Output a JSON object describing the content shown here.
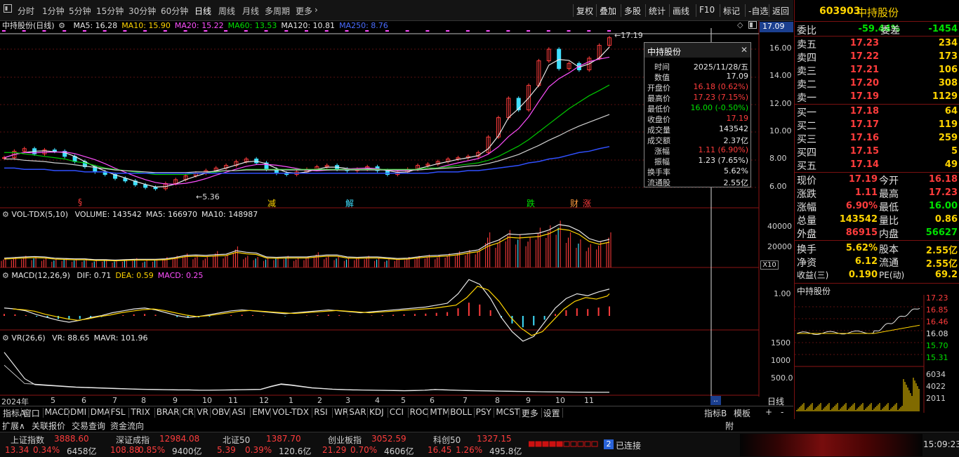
{
  "toolbar": {
    "periods": [
      "分时",
      "1分钟",
      "5分钟",
      "15分钟",
      "30分钟",
      "60分钟",
      "日线",
      "周线",
      "月线",
      "多周期",
      "更多"
    ],
    "active_period": "日线",
    "right_buttons": [
      "复权",
      "叠加",
      "多股",
      "统计",
      "画线",
      "F10",
      "标记",
      "-自选",
      "返回"
    ]
  },
  "stock": {
    "code": "603903",
    "name": "中持股份"
  },
  "main_legend": {
    "title": "中持股份(日线)",
    "items": [
      {
        "text": "MA5: 16.28",
        "color": "#e8e8e8"
      },
      {
        "text": "MA10: 15.90",
        "color": "#ffd400"
      },
      {
        "text": "MA20: 15.22",
        "color": "#ff4fff"
      },
      {
        "text": "MA60: 13.53",
        "color": "#00e000"
      },
      {
        "text": "MA120: 10.81",
        "color": "#e8e8e8"
      },
      {
        "text": "MA250: 8.76",
        "color": "#4a6cff"
      }
    ]
  },
  "price_tag": "17.09",
  "high_mark": "17.19",
  "low_mark": "5.36",
  "price_axis": [
    "16.00",
    "14.00",
    "12.00",
    "10.00",
    "8.00",
    "6.00"
  ],
  "event_marks": [
    "§",
    "减",
    "解",
    "跌",
    "财",
    "涨"
  ],
  "vol_legend": {
    "title": "VOL-TDX(5,10)",
    "items": [
      {
        "text": "VOLUME: 143542",
        "color": "#e8e8e8"
      },
      {
        "text": "MA5: 166970",
        "color": "#e8e8e8"
      },
      {
        "text": "MA10: 148987",
        "color": "#e8e8e8"
      }
    ]
  },
  "vol_axis": [
    "40000",
    "20000"
  ],
  "vol_unit": "X10",
  "macd_legend": {
    "title": "MACD(12,26,9)",
    "items": [
      {
        "text": "DIF: 0.71",
        "color": "#e8e8e8"
      },
      {
        "text": "DEA: 0.59",
        "color": "#ffd400"
      },
      {
        "text": "MACD: 0.25",
        "color": "#ff4fff"
      }
    ]
  },
  "macd_axis": [
    "1.00"
  ],
  "vr_legend": {
    "title": "VR(26,6)",
    "items": [
      {
        "text": "VR: 88.65",
        "color": "#e8e8e8"
      },
      {
        "text": "MAVR: 101.96",
        "color": "#e8e8e8"
      }
    ]
  },
  "vr_axis": [
    "1500",
    "1000",
    "500.0"
  ],
  "time_axis": [
    "2024年",
    "5",
    "6",
    "7",
    "8",
    "9",
    "10",
    "11",
    "12",
    "1",
    "2",
    "3",
    "4",
    "5",
    "6",
    "7",
    "8",
    "9",
    "10",
    "11"
  ],
  "bottom_right_label": "日线",
  "popup": {
    "title": "中持股份",
    "rows": [
      {
        "k": "时间",
        "v": "2025/11/28/五",
        "c": "white"
      },
      {
        "k": "数值",
        "v": "17.09",
        "c": "white"
      },
      {
        "k": "开盘价",
        "v": "16.18 (0.62%)",
        "c": "red"
      },
      {
        "k": "最高价",
        "v": "17.23 (7.15%)",
        "c": "red"
      },
      {
        "k": "最低价",
        "v": "16.00 (-0.50%)",
        "c": "green"
      },
      {
        "k": "收盘价",
        "v": "17.19",
        "c": "red"
      },
      {
        "k": "成交量",
        "v": "143542",
        "c": "white"
      },
      {
        "k": "成交额",
        "v": "2.37亿",
        "c": "white"
      },
      {
        "k": "涨幅",
        "v": "1.11 (6.90%)",
        "c": "red"
      },
      {
        "k": "振幅",
        "v": "1.23 (7.65%)",
        "c": "white"
      },
      {
        "k": "换手率",
        "v": "5.62%",
        "c": "white"
      },
      {
        "k": "流通股",
        "v": "2.55亿",
        "c": "white"
      }
    ]
  },
  "order_book": {
    "ratio": {
      "label": "委比",
      "v1": "-59.44%",
      "label2": "委差",
      "v2": "-1454"
    },
    "sells": [
      {
        "label": "卖五",
        "price": "17.23",
        "vol": "234"
      },
      {
        "label": "卖四",
        "price": "17.22",
        "vol": "173"
      },
      {
        "label": "卖三",
        "price": "17.21",
        "vol": "106"
      },
      {
        "label": "卖二",
        "price": "17.20",
        "vol": "308"
      },
      {
        "label": "卖一",
        "price": "17.19",
        "vol": "1129"
      }
    ],
    "buys": [
      {
        "label": "买一",
        "price": "17.18",
        "vol": "64"
      },
      {
        "label": "买二",
        "price": "17.17",
        "vol": "119"
      },
      {
        "label": "买三",
        "price": "17.16",
        "vol": "259"
      },
      {
        "label": "买四",
        "price": "17.15",
        "vol": "5"
      },
      {
        "label": "买五",
        "price": "17.14",
        "vol": "49"
      }
    ]
  },
  "quote": [
    {
      "l1": "现价",
      "v1": "17.19",
      "c1": "red",
      "l2": "今开",
      "v2": "16.18",
      "c2": "red"
    },
    {
      "l1": "涨跌",
      "v1": "1.11",
      "c1": "red",
      "l2": "最高",
      "v2": "17.23",
      "c2": "red"
    },
    {
      "l1": "涨幅",
      "v1": "6.90%",
      "c1": "red",
      "l2": "最低",
      "v2": "16.00",
      "c2": "green"
    },
    {
      "l1": "总量",
      "v1": "143542",
      "c1": "yellow",
      "l2": "量比",
      "v2": "0.86",
      "c2": "yellow"
    },
    {
      "l1": "外盘",
      "v1": "86915",
      "c1": "red",
      "l2": "内盘",
      "v2": "56627",
      "c2": "green"
    },
    {
      "l1": "换手",
      "v1": "5.62%",
      "c1": "yellow",
      "l2": "股本",
      "v2": "2.55亿",
      "c2": "yellow"
    },
    {
      "l1": "净资",
      "v1": "6.12",
      "c1": "yellow",
      "l2": "流通",
      "v2": "2.55亿",
      "c2": "yellow"
    },
    {
      "l1": "收益(三)",
      "v1": "0.190",
      "c1": "yellow",
      "l2": "PE(动)",
      "v2": "69.2",
      "c2": "yellow"
    }
  ],
  "mini_chart": {
    "title": "中持股份",
    "price_labels": [
      "17.23",
      "16.85",
      "16.46",
      "16.08",
      "15.70",
      "15.31"
    ],
    "vol_labels": [
      "6034",
      "4022",
      "2011"
    ]
  },
  "indicator_tabs": [
    "指标A",
    "窗口",
    "MACD",
    "DMI",
    "DMA",
    "FSL",
    "TRIX",
    "BRAR",
    "CR",
    "VR",
    "OBV",
    "ASI",
    "EMV",
    "VOL-TDX",
    "RSI",
    "WR",
    "SAR",
    "KDJ",
    "CCI",
    "ROC",
    "MTM",
    "BOLL",
    "PSY",
    "MCST",
    "更多",
    "设置"
  ],
  "indicator_right": [
    "指标B",
    "模板",
    "+",
    "-"
  ],
  "bottom_tabs": [
    "扩展∧",
    "关联报价",
    "交易查询",
    "资金流向"
  ],
  "status_corner": "附",
  "indices": [
    {
      "name": "上证指数",
      "value": "3888.60",
      "chg": "13.34",
      "pct": "0.34%",
      "amt": "6458亿"
    },
    {
      "name": "深证成指",
      "value": "12984.08",
      "chg": "108.88",
      "pct": "0.85%",
      "amt": "9400亿"
    },
    {
      "name": "北证50",
      "value": "1387.70",
      "chg": "5.39",
      "pct": "0.39%",
      "amt": "120.6亿"
    },
    {
      "name": "创业板指",
      "value": "3052.59",
      "chg": "21.29",
      "pct": "0.70%",
      "amt": "4606亿"
    },
    {
      "name": "科创50",
      "value": "1327.15",
      "chg": "16.45",
      "pct": "1.26%",
      "amt": "495.8亿"
    }
  ],
  "connection": {
    "badge": "2",
    "text": "已连接"
  },
  "clock": "15:09:23",
  "chart_data": {
    "type": "line",
    "ylim": [
      5,
      17.5
    ],
    "close": [
      7.9,
      8.4,
      8.6,
      8.2,
      8.5,
      8.4,
      8.0,
      7.6,
      7.2,
      6.8,
      6.6,
      6.3,
      6.1,
      5.8,
      5.6,
      5.5,
      5.9,
      6.2,
      6.5,
      6.7,
      6.9,
      7.1,
      7.3,
      7.6,
      7.8,
      7.5,
      7.0,
      6.7,
      6.6,
      6.8,
      7.0,
      7.2,
      7.3,
      7.0,
      6.9,
      7.0,
      7.2,
      6.9,
      6.6,
      6.8,
      7.0,
      7.3,
      7.4,
      7.6,
      7.8,
      7.9,
      8.0,
      8.3,
      9.5,
      11.0,
      12.5,
      11.6,
      13.5,
      15.4,
      16.3,
      14.8,
      15.2,
      14.7,
      15.6,
      16.6,
      17.19
    ],
    "ma60": [
      8.3,
      8.3,
      8.2,
      8.1,
      8.0,
      7.9,
      7.8,
      7.6,
      7.5,
      7.3,
      7.1,
      7.0,
      6.9,
      6.8,
      6.7,
      6.6,
      6.6,
      6.6,
      6.6,
      6.7,
      6.7,
      6.8,
      6.9,
      6.9,
      7.0,
      7.0,
      7.0,
      7.0,
      7.0,
      7.0,
      7.0,
      7.0,
      7.0,
      7.0,
      7.0,
      7.0,
      7.0,
      7.0,
      7.0,
      7.0,
      7.0,
      7.0,
      7.1,
      7.1,
      7.2,
      7.3,
      7.4,
      7.5,
      7.7,
      8.0,
      8.4,
      8.8,
      9.3,
      9.9,
      10.5,
      11.1,
      11.7,
      12.2,
      12.7,
      13.1,
      13.53
    ],
    "ma250": [
      7.1,
      7.1,
      7.0,
      7.0,
      7.0,
      6.9,
      6.9,
      6.9,
      6.8,
      6.8,
      6.8,
      6.7,
      6.7,
      6.7,
      6.7,
      6.7,
      6.7,
      6.7,
      6.7,
      6.7,
      6.7,
      6.7,
      6.7,
      6.7,
      6.7,
      6.7,
      6.7,
      6.7,
      6.7,
      6.7,
      6.7,
      6.7,
      6.7,
      6.7,
      6.7,
      6.7,
      6.7,
      6.7,
      6.7,
      6.7,
      6.7,
      6.7,
      6.7,
      6.8,
      6.8,
      6.8,
      6.9,
      6.9,
      7.0,
      7.1,
      7.2,
      7.3,
      7.5,
      7.6,
      7.8,
      7.9,
      8.1,
      8.3,
      8.4,
      8.6,
      8.76
    ],
    "volume": [
      8,
      9,
      10,
      9,
      8,
      7,
      8,
      7,
      7,
      6,
      7,
      6,
      7,
      8,
      6,
      7,
      9,
      10,
      12,
      10,
      9,
      14,
      11,
      18,
      10,
      9,
      8,
      9,
      10,
      8,
      9,
      13,
      10,
      9,
      8,
      9,
      10,
      8,
      7,
      8,
      9,
      10,
      11,
      10,
      12,
      14,
      15,
      16,
      30,
      24,
      32,
      28,
      26,
      34,
      36,
      40,
      30,
      24,
      20,
      22,
      30
    ],
    "macd": [
      0.05,
      0.04,
      0.02,
      -0.02,
      -0.05,
      -0.08,
      -0.1,
      -0.08,
      -0.05,
      -0.03,
      0.0,
      0.02,
      0.04,
      0.05,
      0.03,
      0.0,
      -0.03,
      -0.05,
      -0.04,
      -0.02,
      0.0,
      0.02,
      0.03,
      0.02,
      0.01,
      0.0,
      -0.01,
      0.0,
      0.01,
      0.02,
      0.03,
      0.02,
      0.01,
      0.0,
      0.01,
      0.02,
      0.03,
      0.04,
      0.05,
      0.06,
      0.08,
      0.1,
      0.2,
      0.35,
      0.3,
      0.15,
      -0.05,
      -0.2,
      -0.3,
      -0.25,
      -0.1,
      0.05,
      0.15,
      0.2,
      0.18,
      0.22,
      0.25
    ],
    "vr": [
      1300,
      900,
      500,
      320,
      300,
      280,
      260,
      240,
      230,
      220,
      210,
      200,
      190,
      180,
      175,
      170,
      165,
      160,
      160,
      150,
      150,
      155,
      160,
      165,
      170,
      175,
      260,
      330,
      300,
      260,
      220,
      200,
      180,
      170,
      160,
      155,
      150,
      145,
      140,
      135,
      140,
      150,
      170,
      160,
      150,
      140,
      135,
      130,
      125,
      120,
      115,
      110,
      105,
      100,
      98,
      95,
      92,
      90,
      89,
      88.65
    ]
  }
}
